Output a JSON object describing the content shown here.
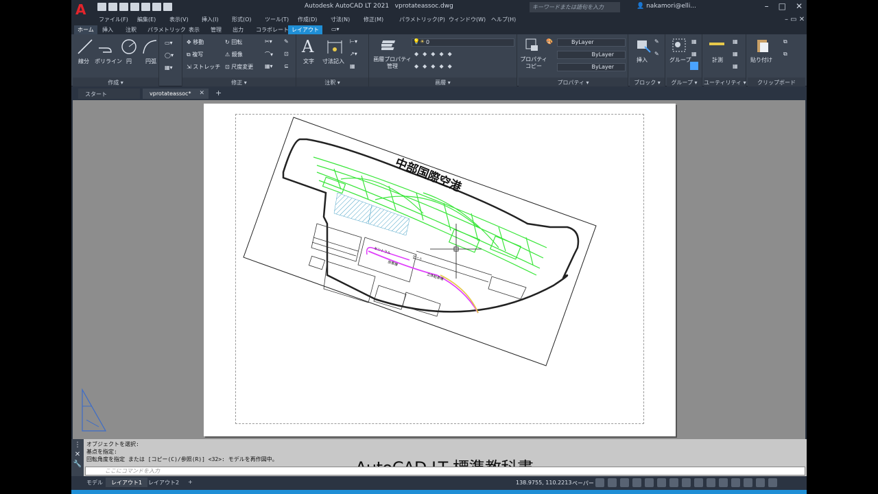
{
  "window": {
    "app_title": "Autodesk AutoCAD LT 2021",
    "file_name": "vprotateassoc.dwg",
    "search_placeholder": "キーワードまたは語句を入力",
    "user": "nakamori@elli...",
    "logo_letter": "A"
  },
  "menu": [
    "ファイル(F)",
    "編集(E)",
    "表示(V)",
    "挿入(I)",
    "形式(O)",
    "ツール(T)",
    "作成(D)",
    "寸法(N)",
    "修正(M)",
    "パラメトリック(P)",
    "ウィンドウ(W)",
    "ヘルプ(H)"
  ],
  "ribbon_tabs": [
    "ホーム",
    "挿入",
    "注釈",
    "パラメトリック",
    "表示",
    "管理",
    "出力",
    "コラボレート",
    "レイアウト"
  ],
  "ribbon": {
    "draw": {
      "title": "作成 ▾",
      "line": "線分",
      "polyline": "ポリライン",
      "circle": "円",
      "arc": "円弧"
    },
    "modify": {
      "title": "修正 ▾",
      "move": "移動",
      "rotate": "回転",
      "copy": "複写",
      "mirror": "鏡像",
      "stretch": "ストレッチ",
      "scale": "尺度変更"
    },
    "annotation": {
      "title": "注釈 ▾",
      "text": "文字",
      "dimension": "寸法記入"
    },
    "layers": {
      "title": "画層 ▾",
      "layer_props": "画層プロパティ管理",
      "current_layer": "0"
    },
    "properties": {
      "title": "プロパティ ▾",
      "match": "プロパティコピー",
      "bylayer1": "ByLayer",
      "bylayer2": "ByLayer",
      "bylayer3": "ByLayer"
    },
    "block": {
      "title": "ブロック ▾",
      "insert": "挿入"
    },
    "groups": {
      "title": "グループ ▾",
      "group": "グループ"
    },
    "utilities": {
      "title": "ユーティリティ ▾",
      "measure": "計測"
    },
    "clipboard": {
      "title": "クリップボード",
      "paste": "貼り付け"
    }
  },
  "doc_tabs": {
    "start": "スタート",
    "file": "vprotateassoc*"
  },
  "drawing": {
    "title": "中部国際空港",
    "label_central": "セントラル",
    "label_gate": "ゲート",
    "label_terminal": "旅客棟",
    "label_parking": "立体駐車場"
  },
  "command": {
    "history": [
      "オブジェクトを選択:",
      "基点を指定:",
      "回転角度を指定 または [コピー(C)/参照(R)] <32>: モデルを再作図中。"
    ],
    "placeholder": "ここにコマンドを入力",
    "caption": "AutoCAD LT 標準教科書"
  },
  "status": {
    "tabs": [
      "モデル",
      "レイアウト1",
      "レイアウト2"
    ],
    "coords": "138.9755, 110.2213",
    "paper": "ペーパー"
  },
  "colors": {
    "accent": "#1f8fd6",
    "taxiway": "#39e639",
    "hatch": "#4aa3c7",
    "road_magenta": "#e040fb",
    "road_yellow": "#e6c84a"
  }
}
